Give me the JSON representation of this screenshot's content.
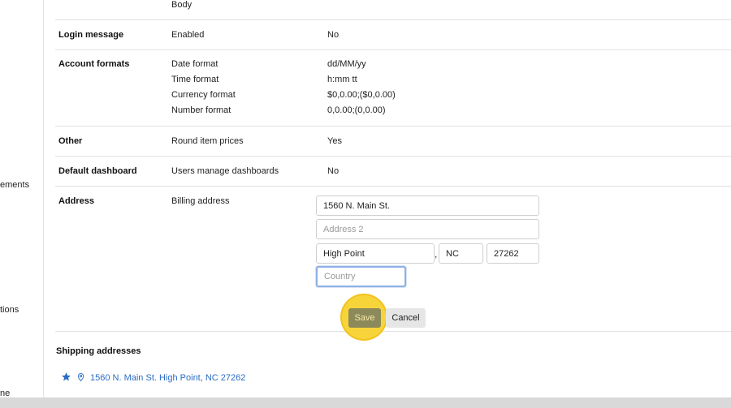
{
  "sidebar": {
    "items": [
      "ements",
      "tions",
      "ne"
    ]
  },
  "rows": {
    "top": {
      "sub": "Body"
    },
    "login": {
      "label": "Login message",
      "sub": "Enabled",
      "value": "No"
    },
    "formats": {
      "label": "Account formats",
      "items": [
        {
          "sub": "Date format",
          "value": "dd/MM/yy"
        },
        {
          "sub": "Time format",
          "value": "h:mm tt"
        },
        {
          "sub": "Currency format",
          "value": "$0,0.00;($0,0.00)"
        },
        {
          "sub": "Number format",
          "value": "0,0.00;(0,0.00)"
        }
      ]
    },
    "other": {
      "label": "Other",
      "sub": "Round item prices",
      "value": "Yes"
    },
    "dashboard": {
      "label": "Default dashboard",
      "sub": "Users manage dashboards",
      "value": "No"
    },
    "address": {
      "label": "Address",
      "sub": "Billing address"
    }
  },
  "address_form": {
    "line1": "1560 N. Main St.",
    "line2_placeholder": "Address 2",
    "city": "High Point",
    "separator": ",",
    "state": "NC",
    "zip": "27262",
    "country_placeholder": "Country"
  },
  "actions": {
    "save": "Save",
    "cancel": "Cancel"
  },
  "shipping": {
    "title": "Shipping addresses",
    "items": [
      {
        "text": "1560 N. Main St. High Point, NC 27262"
      }
    ]
  },
  "colors": {
    "accent": "#2b6cc4",
    "highlight": "#f7d43a",
    "focus": "#8fb0e6"
  }
}
